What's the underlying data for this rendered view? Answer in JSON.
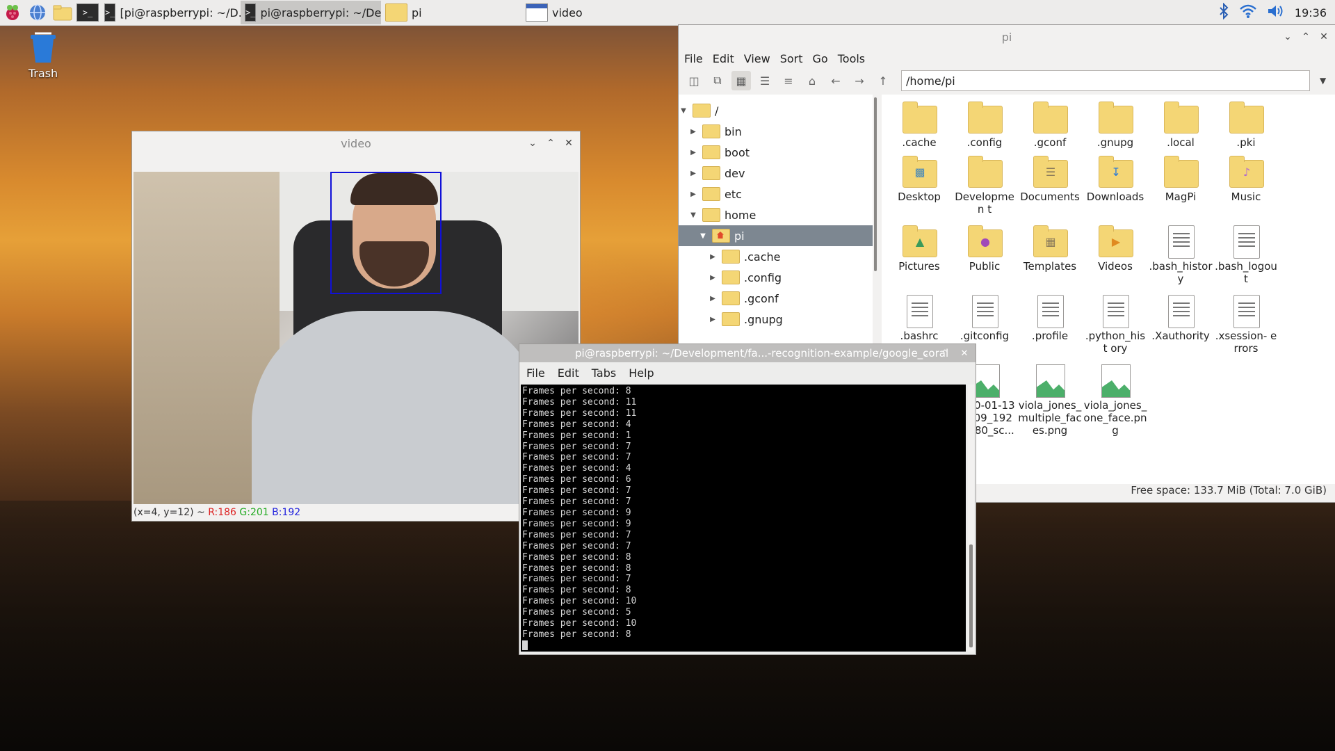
{
  "desktop": {
    "trash_label": "Trash"
  },
  "panel": {
    "tasks": [
      {
        "label": "[pi@raspberrypi: ~/D..."
      },
      {
        "label": "pi@raspberrypi: ~/De..."
      },
      {
        "label": "pi"
      },
      {
        "label": "video"
      }
    ],
    "clock": "19:36"
  },
  "video_window": {
    "title": "video",
    "status_prefix": "(x=4, y=12) ~ ",
    "r": "R:186",
    "g": "G:201",
    "b": "B:192"
  },
  "file_manager": {
    "title": "pi",
    "menu": [
      "File",
      "Edit",
      "View",
      "Sort",
      "Go",
      "Tools"
    ],
    "path": "/home/pi",
    "tree": [
      {
        "label": "/"
      },
      {
        "label": "bin"
      },
      {
        "label": "boot"
      },
      {
        "label": "dev"
      },
      {
        "label": "etc"
      },
      {
        "label": "home"
      },
      {
        "label": "pi"
      },
      {
        "label": ".cache"
      },
      {
        "label": ".config"
      },
      {
        "label": ".gconf"
      },
      {
        "label": ".gnupg"
      }
    ],
    "files": [
      {
        "label": ".cache"
      },
      {
        "label": ".config"
      },
      {
        "label": ".gconf"
      },
      {
        "label": ".gnupg"
      },
      {
        "label": ".local"
      },
      {
        "label": ".pki"
      },
      {
        "label": "Desktop"
      },
      {
        "label": "Developmen t"
      },
      {
        "label": "Documents"
      },
      {
        "label": "Downloads"
      },
      {
        "label": "MagPi"
      },
      {
        "label": "Music"
      },
      {
        "label": "Pictures"
      },
      {
        "label": "Public"
      },
      {
        "label": "Templates"
      },
      {
        "label": "Videos"
      },
      {
        "label": ".bash_histor y"
      },
      {
        "label": ".bash_logou t"
      },
      {
        "label": ".bashrc"
      },
      {
        "label": ".gitconfig"
      },
      {
        "label": ".profile"
      },
      {
        "label": ".python_hist ory"
      },
      {
        "label": ".Xauthority"
      },
      {
        "label": ".xsession- errors"
      },
      {
        "label": "2020-01-13-1509_192 01080_sc..."
      },
      {
        "label": "viola_jones_ multiple_fac es.png"
      },
      {
        "label": "viola_jones_ one_face.pn g"
      }
    ],
    "status": "Free space: 133.7 MiB (Total: 7.0 GiB)"
  },
  "terminal": {
    "title": "pi@raspberrypi: ~/Development/fa...-recognition-example/google_coral",
    "menu": [
      "File",
      "Edit",
      "Tabs",
      "Help"
    ],
    "lines": [
      "Frames per second: 8",
      "Frames per second: 11",
      "Frames per second: 11",
      "Frames per second: 4",
      "Frames per second: 1",
      "Frames per second: 7",
      "Frames per second: 7",
      "Frames per second: 4",
      "Frames per second: 6",
      "Frames per second: 7",
      "Frames per second: 7",
      "Frames per second: 9",
      "Frames per second: 9",
      "Frames per second: 7",
      "Frames per second: 7",
      "Frames per second: 8",
      "Frames per second: 8",
      "Frames per second: 7",
      "Frames per second: 8",
      "Frames per second: 10",
      "Frames per second: 5",
      "Frames per second: 10",
      "Frames per second: 8"
    ]
  },
  "icons": {
    "launcher": [
      "raspberry-menu-icon",
      "web-browser-icon",
      "file-manager-icon",
      "terminal-icon"
    ],
    "tray": [
      "bluetooth-icon",
      "wifi-icon",
      "volume-icon"
    ]
  }
}
